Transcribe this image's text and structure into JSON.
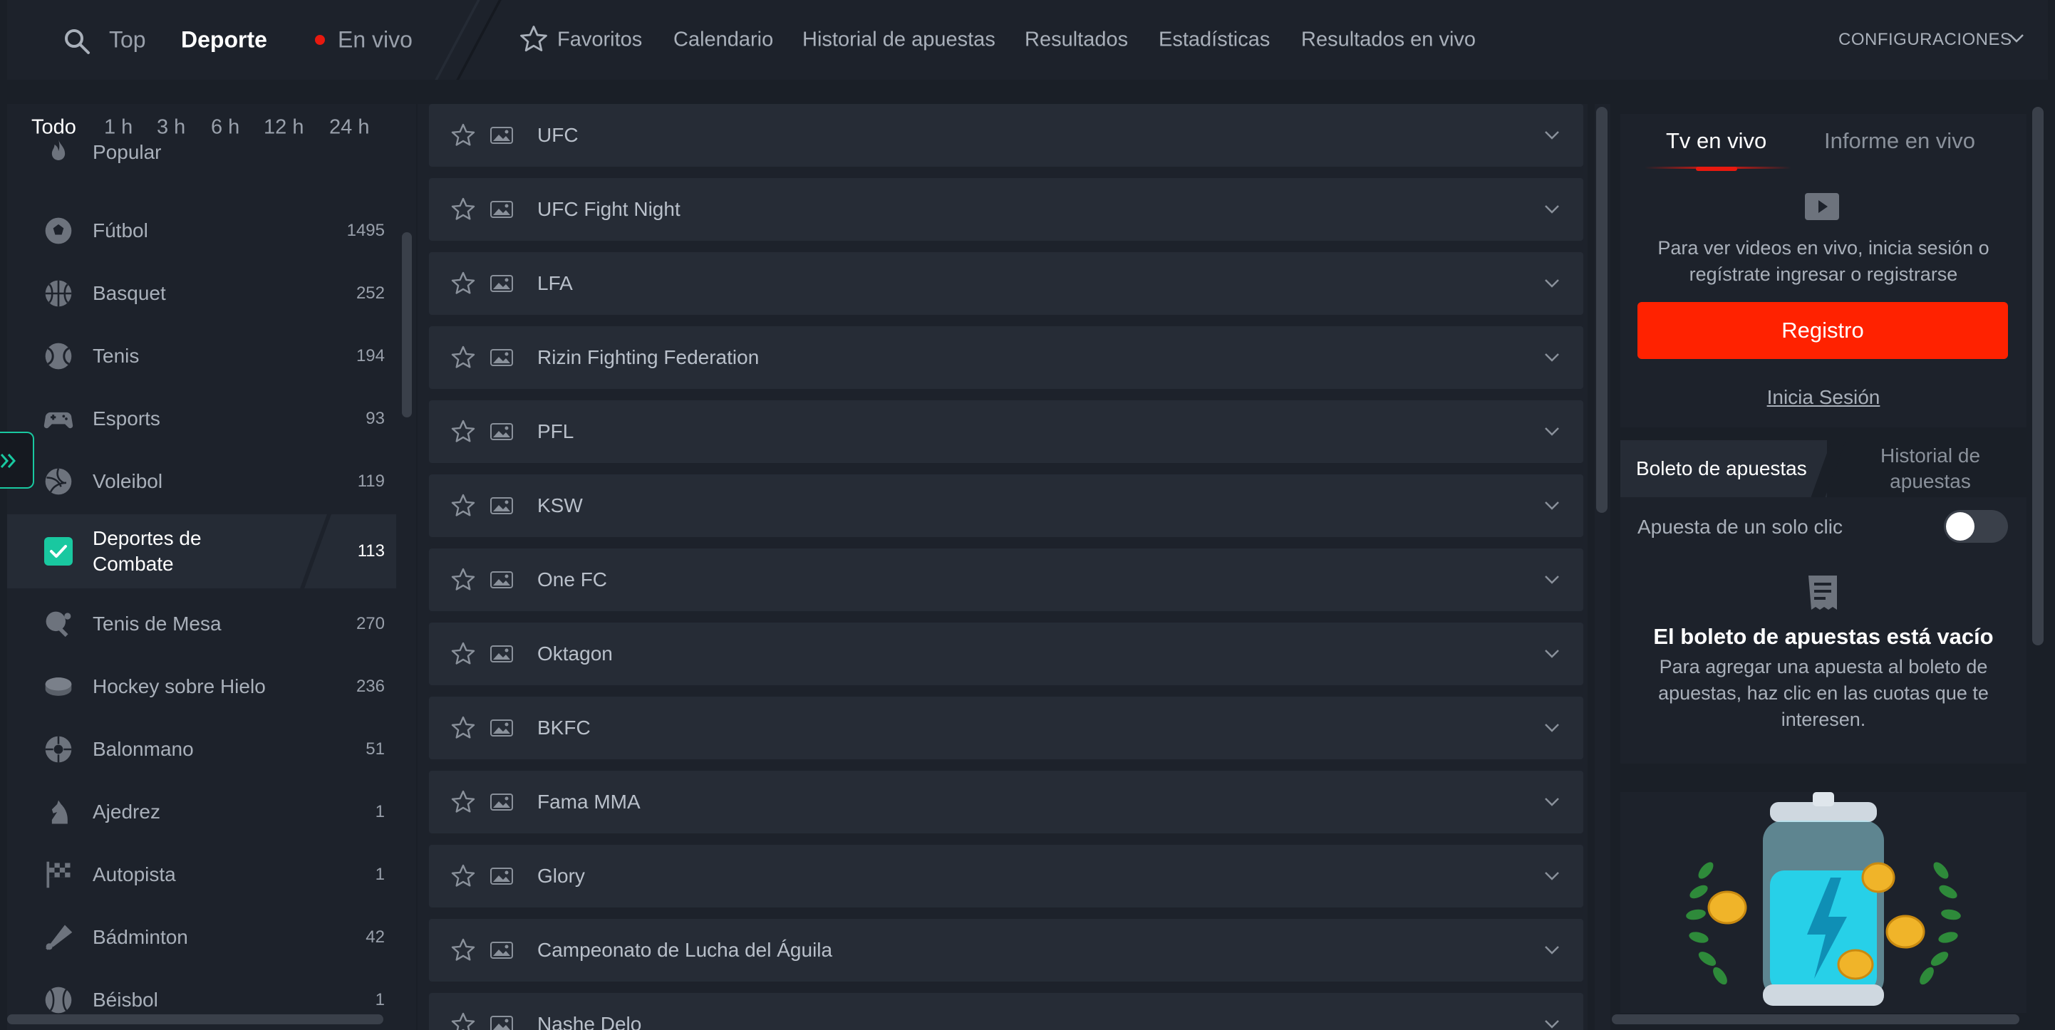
{
  "header": {
    "top": "Top",
    "sport": "Deporte",
    "live": "En vivo",
    "nav": [
      "Favoritos",
      "Calendario",
      "Historial de apuestas",
      "Resultados",
      "Estadísticas",
      "Resultados en vivo"
    ],
    "settings": "CONFIGURACIONES"
  },
  "filters": [
    "Todo",
    "1 h",
    "3 h",
    "6 h",
    "12 h",
    "24 h"
  ],
  "sports": [
    {
      "name": "Popular",
      "count": "",
      "icon": "fire-icon"
    },
    {
      "name": "Fútbol",
      "count": "1495",
      "icon": "soccer-ball-icon"
    },
    {
      "name": "Basquet",
      "count": "252",
      "icon": "basketball-icon"
    },
    {
      "name": "Tenis",
      "count": "194",
      "icon": "tennis-ball-icon"
    },
    {
      "name": "Esports",
      "count": "93",
      "icon": "gamepad-icon"
    },
    {
      "name": "Voleibol",
      "count": "119",
      "icon": "volleyball-icon"
    },
    {
      "name": "Deportes de Combate",
      "count": "113",
      "icon": "checkbox-icon",
      "selected": true
    },
    {
      "name": "Tenis de Mesa",
      "count": "270",
      "icon": "table-tennis-icon"
    },
    {
      "name": "Hockey sobre Hielo",
      "count": "236",
      "icon": "hockey-puck-icon"
    },
    {
      "name": "Balonmano",
      "count": "51",
      "icon": "handball-icon"
    },
    {
      "name": "Ajedrez",
      "count": "1",
      "icon": "chess-knight-icon"
    },
    {
      "name": "Autopista",
      "count": "1",
      "icon": "racing-flag-icon"
    },
    {
      "name": "Bádminton",
      "count": "42",
      "icon": "shuttlecock-icon"
    },
    {
      "name": "Béisbol",
      "count": "1",
      "icon": "baseball-icon"
    }
  ],
  "leagues": [
    "UFC",
    "UFC Fight Night",
    "LFA",
    "Rizin Fighting Federation",
    "PFL",
    "KSW",
    "One FC",
    "Oktagon",
    "BKFC",
    "Fama MMA",
    "Glory",
    "Campeonato de Lucha del Águila",
    "Nashe Delo"
  ],
  "tv": {
    "tab_live_tv": "Tv en vivo",
    "tab_live_report": "Informe en vivo",
    "message": "Para ver videos en vivo, inicia sesión o regístrate ingresar o registrarse",
    "register": "Registro",
    "login": "Inicia Sesión"
  },
  "betslip": {
    "tab_slip": "Boleto de apuestas",
    "tab_history": "Historial de apuestas",
    "one_click": "Apuesta de un solo clic",
    "one_click_enabled": false,
    "empty_title": "El boleto de apuestas está vacío",
    "empty_text": "Para agregar una apuesta al boleto de apuestas, haz clic en las cuotas que te interesen."
  },
  "colors": {
    "accent_red": "#ff2200",
    "accent_teal": "#19c8a0"
  }
}
